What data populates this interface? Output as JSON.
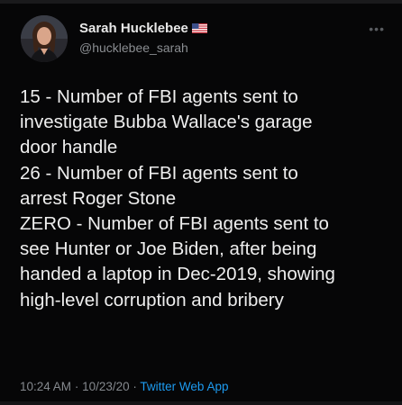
{
  "author": {
    "name": "Sarah Hucklebee",
    "flag": "us-flag-icon",
    "handle": "@hucklebee_sarah"
  },
  "more_icon": "•••",
  "tweet": {
    "lines": [
      "15 - Number of FBI agents sent to",
      "investigate Bubba Wallace's garage",
      "door handle",
      "26 - Number of FBI agents sent to",
      "arrest Roger Stone",
      "ZERO - Number of FBI agents sent to",
      "see Hunter or Joe Biden, after being",
      "handed a laptop in Dec-2019, showing",
      "high-level corruption and bribery"
    ]
  },
  "meta": {
    "time": "10:24 AM",
    "date": "10/23/20",
    "separator": "·",
    "source": "Twitter Web App"
  },
  "colors": {
    "background": "#060607",
    "text": "#eeeeee",
    "muted": "#85898e",
    "link": "#1d9bf0"
  }
}
